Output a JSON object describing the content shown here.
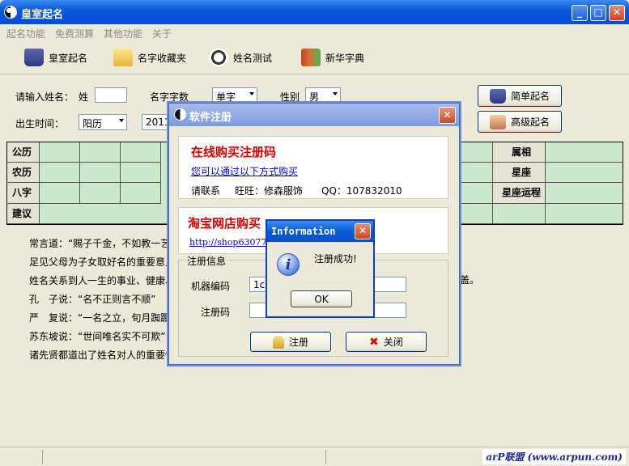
{
  "window": {
    "title": "皇室起名",
    "min": "_",
    "max": "□",
    "close": "✕"
  },
  "menu": [
    "起名功能",
    "免费测算",
    "其他功能",
    "关于"
  ],
  "toolbar": {
    "items": [
      "皇室起名",
      "名字收藏夹",
      "姓名测试",
      "新华字典"
    ]
  },
  "form": {
    "name_label": "请输入姓名：",
    "surname_label": "姓",
    "surname_value": "",
    "count_label": "名字字数",
    "count_value": "单字",
    "gender_label": "性别",
    "gender_value": "男",
    "birth_label": "出生时间：",
    "calendar_value": "阳历",
    "year_value": "2011",
    "simple_btn": "简单起名",
    "advanced_btn": "高级起名"
  },
  "grid": {
    "rows": [
      "公历",
      "农历",
      "八字",
      "建议"
    ],
    "right_labels": [
      "属相",
      "星座",
      "星座运程"
    ]
  },
  "intro": [
    "常言道：“赐子千金，不如教一艺",
    "足见父母为子女取好名的重要意义",
    "姓名关系到人一生的事业、健康、",
    "孔　子说：“名不正则言不顺”",
    "严　复说：“一名之立，旬月踟蹰",
    "苏东坡说：“世间唯名实不可欺”",
    "诸先贤都道出了姓名对人的重要性"
  ],
  "intro_tail": "盖。",
  "status": {
    "watermark": "arP联盟 (www.arpun.com)"
  },
  "dialog": {
    "title": "软件注册",
    "close": "✕",
    "online_title": "在线购买注册码",
    "online_link": "您可以通过以下方式购买",
    "contact_label": "请联系",
    "wangwang": "旺旺：修森服饰",
    "qq": "QQ：107832010",
    "taobao_title": "淘宝网店购买",
    "taobao_link": "http://shop63077",
    "reg_info_label": "注册信息",
    "machine_label": "机器编码",
    "machine_value": "1c7",
    "code_label": "注册码",
    "code_value": "",
    "register_btn": "注册",
    "close_btn": "关闭"
  },
  "info_box": {
    "title": "Information",
    "close": "✕",
    "icon": "i",
    "message": "注册成功!",
    "ok": "OK"
  }
}
